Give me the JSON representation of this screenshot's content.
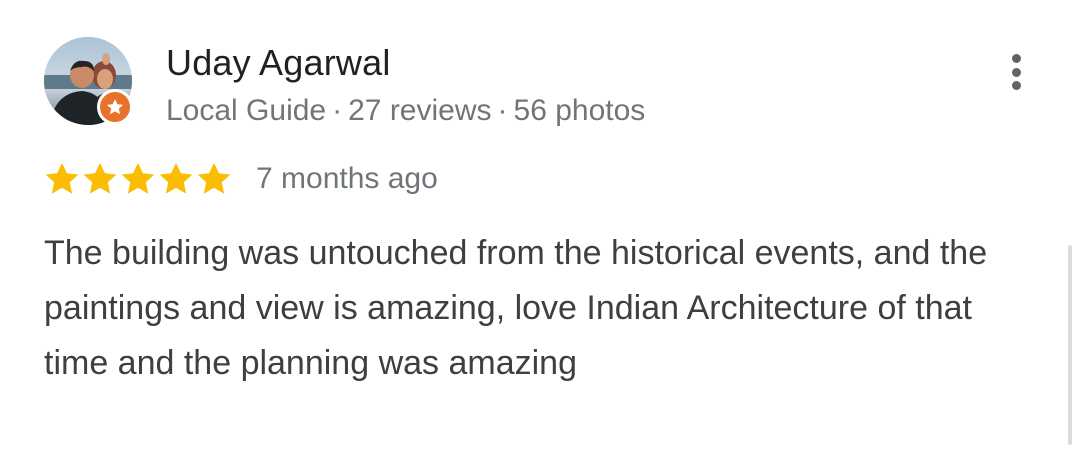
{
  "review": {
    "reviewer": {
      "name": "Uday Agarwal",
      "badge": "Local Guide",
      "separator": "·",
      "reviews": "27 reviews",
      "photos": "56 photos"
    },
    "rating": {
      "stars": 5,
      "max": 5
    },
    "time_ago": "7 months ago",
    "text": "The building was untouched from the historical events, and the paintings and view is amazing, love Indian Architecture of that time and the planning was amazing"
  },
  "icons": {
    "avatar": "avatar-photo",
    "badge": "local-guide-star-icon",
    "more": "more-vert-icon",
    "star": "star-icon"
  },
  "colors": {
    "star": "#fbbc04",
    "badge": "#e8712c",
    "name": "#202124",
    "meta": "#70757a",
    "body_text": "#3c4043",
    "more_dots": "#5f6368"
  }
}
